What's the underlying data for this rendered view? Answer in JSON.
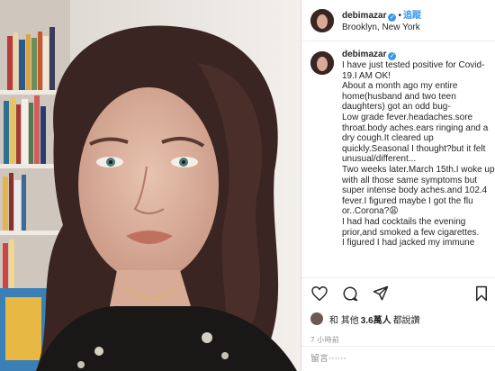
{
  "post": {
    "username": "debimazar",
    "follow_label": "追蹤",
    "separator": "•",
    "location": "Brooklyn, New York",
    "caption_lines": [
      "I have just tested positive for Covid-19.I AM OK!",
      "About a month ago my entire home(husband and two teen daughters) got an odd bug-",
      "Low grade fever.headaches.sore throat.body aches.ears ringing and a dry cough.It cleared up quickly.Seasonal I thought?but it felt unusual/different...",
      "Two weeks later.March 15th.I woke up with all those same symptoms but super intense body aches.and 102.4 fever.I figured maybe I got the flu or..Corona?😩",
      "I had had cocktails the evening prior,and smoked a few cigarettes.",
      "I figured I had jacked my immune"
    ],
    "likes_prefix": "和 其他",
    "likes_count": "3.6萬人",
    "likes_suffix": "都說讚",
    "timestamp": "7 小時前",
    "comment_placeholder": "留言⋯⋯"
  },
  "icons": {
    "verified": "verified-badge-icon",
    "like": "heart-icon",
    "comment": "comment-icon",
    "share": "share-icon",
    "save": "bookmark-icon"
  },
  "colors": {
    "link": "#3897f0",
    "text": "#262626",
    "muted": "#8e8e8e",
    "border": "#dbdbdb"
  }
}
